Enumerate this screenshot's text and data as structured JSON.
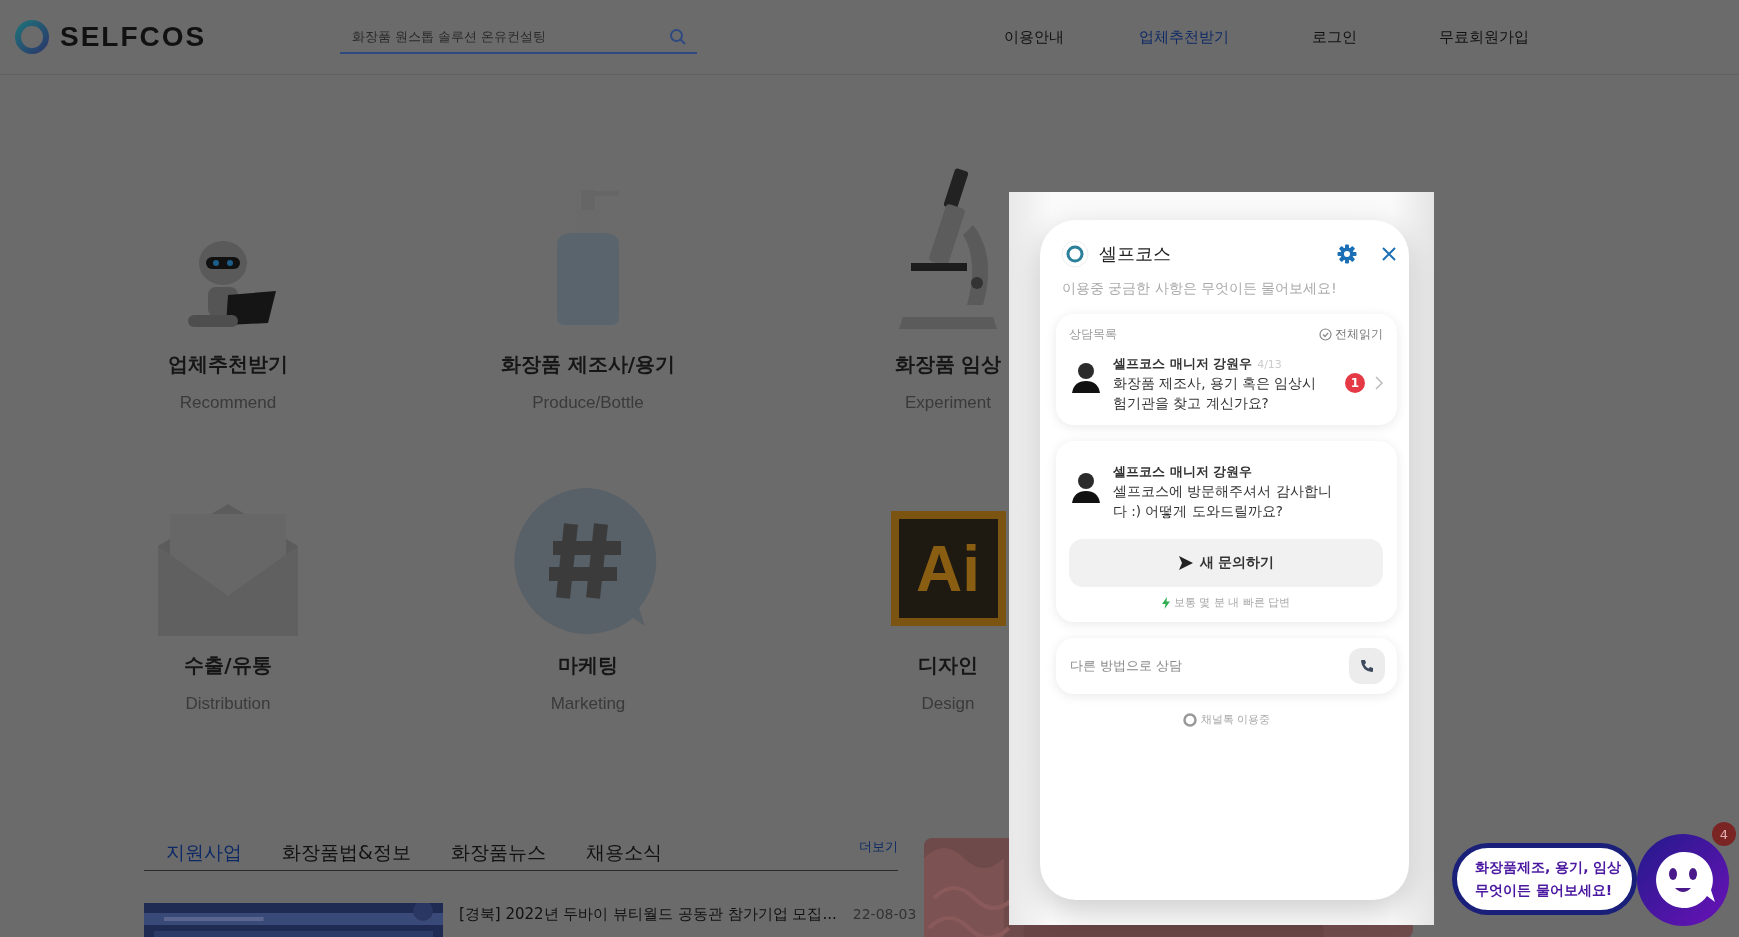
{
  "header": {
    "logo": "SELFCOS",
    "search": {
      "placeholder": "화장품 원스톱 솔루션 온유컨설팅"
    },
    "nav": [
      {
        "label": "이용안내",
        "selected": false
      },
      {
        "label": "업체추천받기",
        "selected": true
      },
      {
        "label": "로그인",
        "selected": false
      },
      {
        "label": "무료회원가입",
        "selected": false
      }
    ]
  },
  "categories": [
    {
      "kind": "robot",
      "title": "업체추천받기",
      "subtitle": "Recommend"
    },
    {
      "kind": "bottle",
      "title": "화장품 제조사/용기",
      "subtitle": "Produce/Bottle"
    },
    {
      "kind": "microscope",
      "title": "화장품 임상",
      "subtitle": "Experiment"
    },
    {
      "kind": "envelope",
      "title": "수출/유통",
      "subtitle": "Distribution"
    },
    {
      "kind": "hashtag",
      "title": "마케팅",
      "subtitle": "Marketing"
    },
    {
      "kind": "ai",
      "title": "디자인",
      "subtitle": "Design",
      "icon_text": "Ai"
    }
  ],
  "news": {
    "tabs": [
      {
        "label": "지원사업",
        "selected": true
      },
      {
        "label": "화장품법&정보",
        "selected": false
      },
      {
        "label": "화장품뉴스",
        "selected": false
      },
      {
        "label": "채용소식",
        "selected": false
      }
    ],
    "more": "더보기",
    "items": [
      {
        "title": "[경북] 2022년 두바이 뷰티월드 공동관 참가기업 모집...",
        "date": "22-08-03"
      }
    ]
  },
  "chat_panel": {
    "title": "셀프코스",
    "subtitle": "이용중 궁금한 사항은 무엇이든 물어보세요!",
    "list_label": "상담목록",
    "read_all": "전체읽기",
    "conversations": [
      {
        "sender": "셀프코스 매니저 강원우",
        "date": "4/13",
        "message": "화장품 제조사, 용기 혹은 임상시험기관을 찾고 계신가요?",
        "unread": "1"
      }
    ],
    "greeting": {
      "sender": "셀프코스 매니저 강원우",
      "message": "셀프코스에 방문해주셔서 감사합니다 :) 어떻게 도와드릴까요?"
    },
    "new_button": "새 문의하기",
    "response_note": "보통 몇 분 내 빠른 답변",
    "other_label": "다른 방법으로 상담",
    "footer": "채널톡 이용중"
  },
  "launcher": {
    "lines": [
      "화장품제조, 용기, 임상",
      "무엇이든 물어보세요!"
    ],
    "badge": "4"
  }
}
